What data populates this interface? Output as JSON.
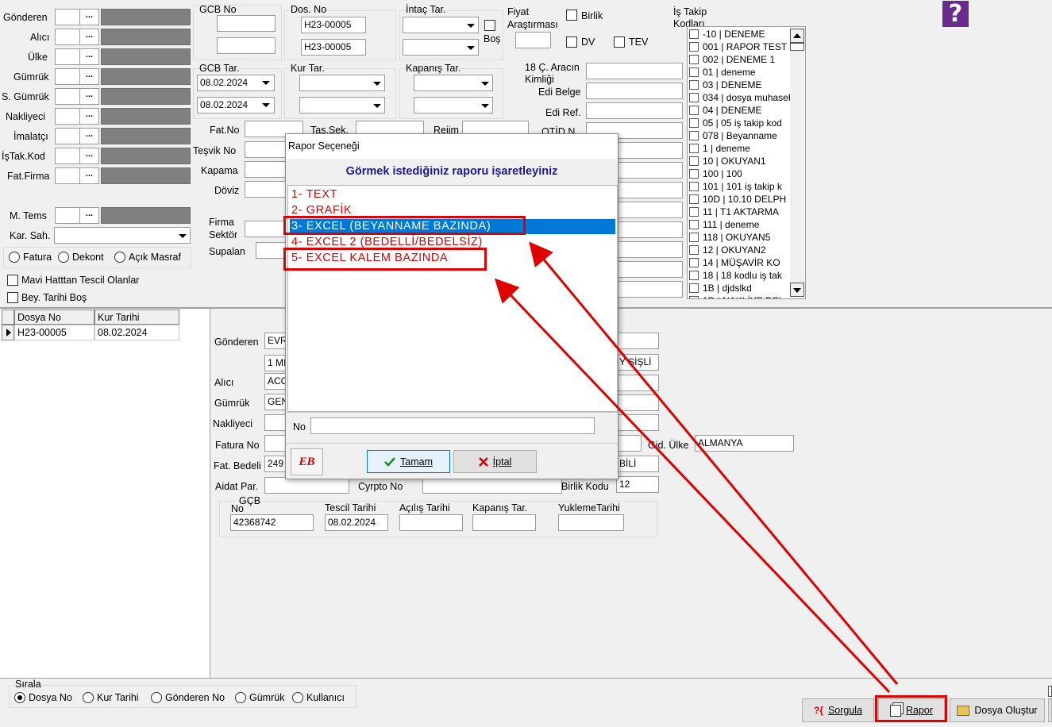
{
  "filters": {
    "gonderen": "Gönderen",
    "alici": "Alıcı",
    "ulke": "Ülke",
    "gumruk": "Gümrük",
    "s_gumruk": "S. Gümrük",
    "nakliyeci": "Nakliyeci",
    "imalatci": "İmalatçı",
    "istakkod": "İşTak.Kod",
    "fatfirma": "Fat.Firma",
    "mtems": "M. Tems",
    "karsah": "Kar. Sah.",
    "dots": "...",
    "radios": [
      "Fatura",
      "Dekont",
      "Açık Masraf"
    ],
    "mavi": "Mavi Hatttan Tescil Olanlar",
    "beytarihi": "Bey. Tarihi Boş"
  },
  "mid": {
    "gcbno": "GCB No",
    "dosno": "Dos. No",
    "dosno_val1": "H23-00005",
    "dosno_val2": "H23-00005",
    "intac": "İntaç Tar.",
    "bos": "Boş",
    "fiyat1": "Fiyat",
    "fiyat2": "Araştırması",
    "birlik": "Birlik",
    "dv": "DV",
    "tev": "TEV",
    "gcbtar": "GCB Tar.",
    "date1": "08.02.2024",
    "date2": "08.02.2024",
    "kurtar": "Kur Tar.",
    "kapanis": "Kapanış Tar.",
    "arac1": "18 Ç. Aracın",
    "arac2": "Kimliği",
    "edibelge": "Edi Belge",
    "ediref": "Edi Ref.",
    "fatno": "Fat.No",
    "tassek": "Taş.Şek.",
    "rejim": "Rejim",
    "otid": "OTİD N",
    "tesvik": "Teşvik No",
    "kapama": "Kapama",
    "doviz": "Döviz",
    "firma1": "Firma",
    "firma2": "Sektör",
    "supalan": "Supalan",
    "istakip1": "İş Takip",
    "istakip2": "Kodları"
  },
  "istakip": [
    "-10 | DENEME",
    "001 | RAPOR TEST",
    "002 | DENEME 1",
    "01 | deneme",
    "03 | DENEME",
    "034 | dosya muhasebe",
    "04 | DENEME",
    "05 | 05 iş takip kod",
    "078 | Beyanname",
    "1 | deneme",
    "10 | OKUYAN1",
    "100 | 100",
    "101 | 101 iş takip k",
    "10D | 10.10 DELPH",
    "11 | T1 AKTARMA",
    "111 | deneme",
    "118 | OKUYAN5",
    "12 | OKUYAN2",
    "14 | MÜŞAVİR KO",
    "18 | 18 kodlu iş tak",
    "1B | djdslkd",
    "1D | NAKLİYE DEL"
  ],
  "grid": {
    "col1": "Dosya No",
    "col2": "Kur Tarihi",
    "rows": [
      {
        "dosya": "H23-00005",
        "kur": "08.02.2024"
      }
    ]
  },
  "detail": {
    "gonderen": "Gönderen",
    "gonderen_val": "EVR",
    "addr": "1 MI",
    "sisli": "Y ŞİŞLİ",
    "alici": "Alıcı",
    "alici_val": "ACC",
    "gumruk": "Gümrük",
    "gumruk_val": "GEN",
    "nakliyeci": "Nakliyeci",
    "faturano": "Fatura No",
    "gidulke": "Gid. Ülke",
    "gidulke_val": "ALMANYA",
    "fatbedeli": "Fat. Bedeli",
    "fatbedeli_val": "249",
    "bili": "BİLİ",
    "aidat": "Aidat Par.",
    "cyrpto": "Cyrpto No",
    "birlikkodu": "Birlik Kodu",
    "birlikkodu_val": "12",
    "gcb": "GÇB",
    "no": "No",
    "no_val": "42368742",
    "tescil": "Tescil Tarihi",
    "tescil_val": "08.02.2024",
    "acilis": "Açılış Tarihi",
    "kapanis": "Kapanış Tar.",
    "yukleme": "YuklemeTarihi"
  },
  "sort": {
    "title": "Sırala",
    "options": [
      "Dosya No",
      "Kur Tarihi",
      "Gönderen No",
      "Gümrük",
      "Kullanıcı"
    ]
  },
  "buttons": {
    "sorgula": "Sorgula",
    "rapor": "Rapor",
    "dosya": "Dosya Oluştur"
  },
  "dialog": {
    "title": "Rapor Seçeneği",
    "header": "Görmek istediğiniz raporu işaretleyiniz",
    "items": [
      "1- TEXT",
      "2- GRAFİK",
      "3- EXCEL (BEYANNAME BAZINDA)",
      "4- EXCEL 2 (BEDELLİ/BEDELSİZ)",
      "5- EXCEL KALEM BAZINDA"
    ],
    "no": "No",
    "ok": "Tamam",
    "cancel": "İptal",
    "logo": "EB"
  },
  "colors": {
    "selection": "#0078d7",
    "annotation": "#e00000",
    "header_text": "#1a1a8e",
    "item_text": "#d40000"
  }
}
